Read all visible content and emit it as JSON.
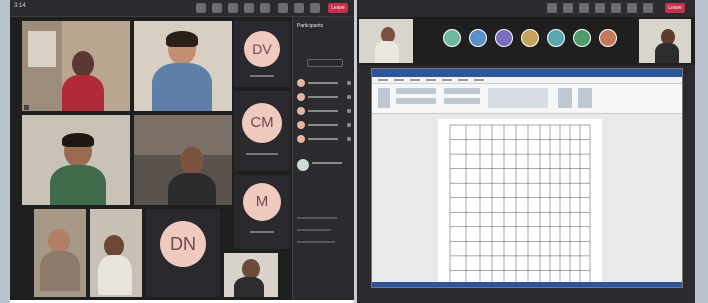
{
  "left": {
    "clock": "3:14",
    "leave_label": "Leave",
    "participants_title": "Participants",
    "avatars": [
      {
        "initials": "DV"
      },
      {
        "initials": "CM"
      },
      {
        "initials": "M"
      },
      {
        "initials": "DN"
      }
    ]
  },
  "right": {
    "leave_label": "Leave",
    "chip_colors": [
      "#6fb7a0",
      "#5b8fc7",
      "#7b6cc2",
      "#c4a35a",
      "#5aa7b0",
      "#4f9b6a",
      "#c47a5a",
      "#6a8fd0"
    ]
  },
  "colors": {
    "teams_dark": "#2b2b2f",
    "avatar_bg": "#f0c9bf",
    "avatar_text": "#6b4b4b",
    "leave_red": "#c4314b",
    "word_blue": "#2b579a"
  }
}
